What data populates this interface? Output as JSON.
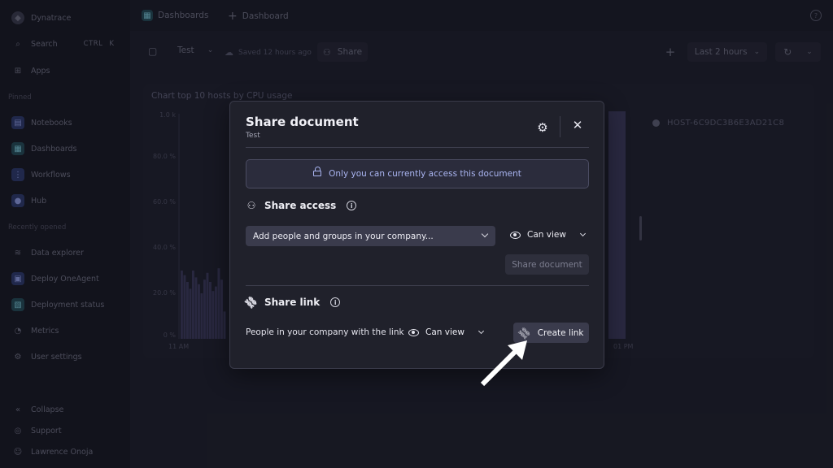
{
  "sidebar": {
    "brand": "Dynatrace",
    "search_label": "Search",
    "search_shortcut": [
      "CTRL",
      "K"
    ],
    "apps_label": "Apps",
    "pinned_label": "Pinned",
    "pinned": [
      "Notebooks",
      "Dashboards",
      "Workflows",
      "Hub"
    ],
    "recent_label": "Recently opened",
    "recent": [
      "Data explorer",
      "Deploy OneAgent",
      "Deployment status",
      "Metrics",
      "User settings"
    ],
    "footer": [
      "Collapse",
      "Support",
      "Lawrence Onoja"
    ]
  },
  "topbar": {
    "breadcrumb_app": "Dashboards",
    "new_dashboard": "Dashboard"
  },
  "toolbar": {
    "doc_name": "Test",
    "saved_status": "Saved 12 hours ago",
    "share_label": "Share",
    "timeframe": "Last 2 hours"
  },
  "tile": {
    "title": "Chart top 10 hosts by CPU usage",
    "y_ticks": [
      "1.0 k",
      "80.0 %",
      "60.0 %",
      "40.0 %",
      "20.0 %",
      "0 %"
    ],
    "x_ticks": [
      "11 AM",
      "01 PM"
    ],
    "legend": "HOST-6C9DC3B6E3AD21C8"
  },
  "chart_data": {
    "type": "bar",
    "title": "Chart top 10 hosts by CPU usage",
    "ylabel": "",
    "xlabel": "",
    "x_ticks": [
      "11 AM",
      "01 PM"
    ],
    "series": [
      {
        "name": "HOST-6C9DC3B6E3AD21C8",
        "values": [
          30,
          28,
          25,
          22,
          30,
          27,
          24,
          20,
          26,
          29,
          25,
          21,
          23,
          31,
          26,
          12
        ]
      }
    ],
    "ylim": [
      0,
      100
    ],
    "legend_position": "top-right",
    "colors": {
      "bars": "#3b3a5a"
    }
  },
  "modal": {
    "title": "Share document",
    "subtitle": "Test",
    "access_banner": "Only you can currently access this document",
    "share_access_heading": "Share access",
    "people_placeholder": "Add people and groups in your company...",
    "access_permission": "Can view",
    "share_document_button": "Share document",
    "share_link_heading": "Share link",
    "link_description": "People in your company with the link",
    "link_permission": "Can view",
    "create_link_button": "Create link"
  }
}
